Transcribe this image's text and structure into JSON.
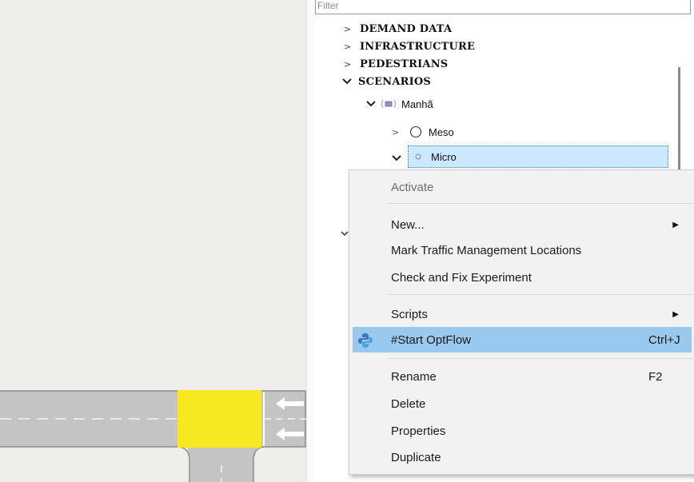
{
  "filter": {
    "placeholder": "Filter"
  },
  "tree": {
    "categories": [
      {
        "label": "DEMAND DATA",
        "expanded": false
      },
      {
        "label": "INFRASTRUCTURE",
        "expanded": false
      },
      {
        "label": "PEDESTRIANS",
        "expanded": false
      },
      {
        "label": "SCENARIOS",
        "expanded": true
      }
    ],
    "scenario": {
      "label": "Manhã",
      "expanded": true
    },
    "experiments": [
      {
        "label": "Meso",
        "expanded": false,
        "selected": false
      },
      {
        "label": "Micro",
        "expanded": true,
        "selected": true
      }
    ]
  },
  "context_menu": {
    "items": [
      {
        "label": "Activate",
        "enabled": false
      },
      {
        "label": "New...",
        "submenu": true
      },
      {
        "label": "Mark Traffic Management Locations"
      },
      {
        "label": "Check and Fix Experiment"
      },
      {
        "label": "Scripts",
        "submenu": true
      },
      {
        "label": "#Start OptFlow",
        "shortcut": "Ctrl+J",
        "highlighted": true,
        "icon": "python-icon"
      },
      {
        "label": "Rename",
        "shortcut": "F2"
      },
      {
        "label": "Delete"
      },
      {
        "label": "Properties"
      },
      {
        "label": "Duplicate"
      }
    ]
  },
  "colors": {
    "road": "#c4c4c4",
    "road_edge": "#8c8c8c",
    "junction": "#f7e81f",
    "selection": "#cce8ff",
    "menu_highlight": "#99c9ef"
  }
}
